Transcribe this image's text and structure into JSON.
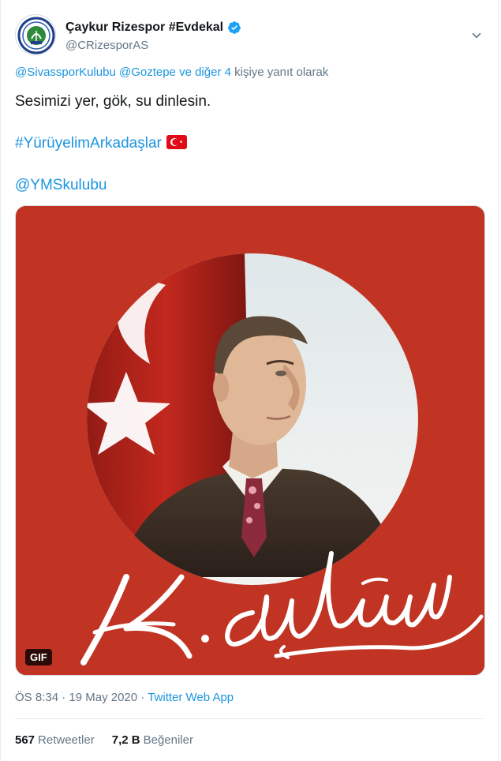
{
  "tweet": {
    "author_name": "Çaykur Rizespor #Evdekal",
    "author_handle": "@CRizesporAS",
    "avatar_icon": "club-crest-icon",
    "verified_icon": "verified-badge-icon",
    "reply": {
      "mention_1": "@SivassporKulubu",
      "mention_2": "@Goztepe",
      "others": "ve diğer 4",
      "suffix": "kişiye yanıt olarak"
    },
    "text": "Sesimizi yer, gök, su dinlesin.",
    "hashtag": "#YürüyelimArkadaşlar",
    "flag_icon": "turkey-flag-icon",
    "mention_line": "@YMSkulubu",
    "media": {
      "badge": "GIF",
      "signature": "K. Atatürk",
      "colors": {
        "background": "#c13322",
        "flag_red": "#b8241b"
      }
    },
    "time": "ÖS 8:34",
    "date": "19 May 2020",
    "source": "Twitter Web App",
    "stats": {
      "retweets_count": "567",
      "retweets_label": "Retweetler",
      "likes_count": "7,2 B",
      "likes_label": "Beğeniler"
    },
    "colors": {
      "link": "#1b95e0",
      "muted": "#657786",
      "text": "#14171a"
    }
  }
}
